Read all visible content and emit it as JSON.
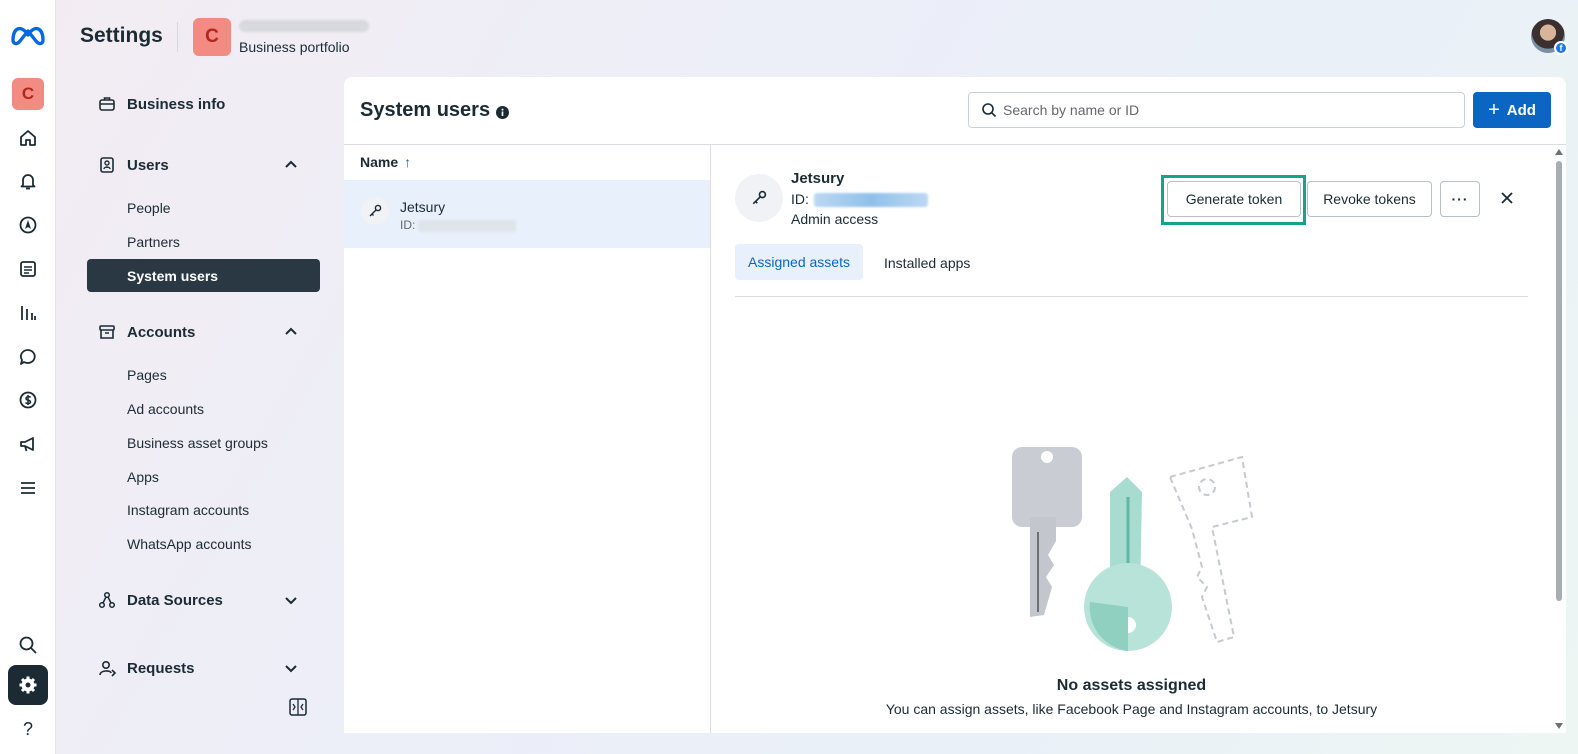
{
  "header": {
    "title": "Settings",
    "portfolio_initial": "C",
    "portfolio_subtitle": "Business portfolio"
  },
  "rail": {
    "badge_initial": "C",
    "icons": [
      "home-icon",
      "bell-icon",
      "compass-icon",
      "pages-icon",
      "insights-icon",
      "chat-icon",
      "dollar-icon",
      "megaphone-icon",
      "menu-icon",
      "search-icon",
      "gear-icon",
      "help-icon"
    ],
    "help_glyph": "?"
  },
  "nav": {
    "business_info": "Business info",
    "users": {
      "label": "Users",
      "items": [
        "People",
        "Partners",
        "System users"
      ]
    },
    "accounts": {
      "label": "Accounts",
      "items": [
        "Pages",
        "Ad accounts",
        "Business asset groups",
        "Apps",
        "Instagram accounts",
        "WhatsApp accounts"
      ]
    },
    "data_sources": "Data Sources",
    "requests": "Requests"
  },
  "page": {
    "title": "System users",
    "search_placeholder": "Search by name or ID",
    "add_label": "Add",
    "add_glyph": "+"
  },
  "list": {
    "column_header": "Name",
    "sort_glyph": "↑",
    "rows": [
      {
        "name": "Jetsury",
        "id_label": "ID:"
      }
    ]
  },
  "detail": {
    "name": "Jetsury",
    "id_label": "ID:",
    "access": "Admin access",
    "generate_token": "Generate token",
    "revoke_tokens": "Revoke tokens",
    "more_glyph": "···",
    "tabs": [
      "Assigned assets",
      "Installed apps"
    ],
    "empty_title": "No assets assigned",
    "empty_desc": "You can assign assets, like Facebook Page and Instagram accounts, to Jetsury"
  },
  "colors": {
    "accent": "#0a66c2",
    "highlight": "#14a38b",
    "active_nav": "#293843",
    "badge": "#f28b82"
  }
}
